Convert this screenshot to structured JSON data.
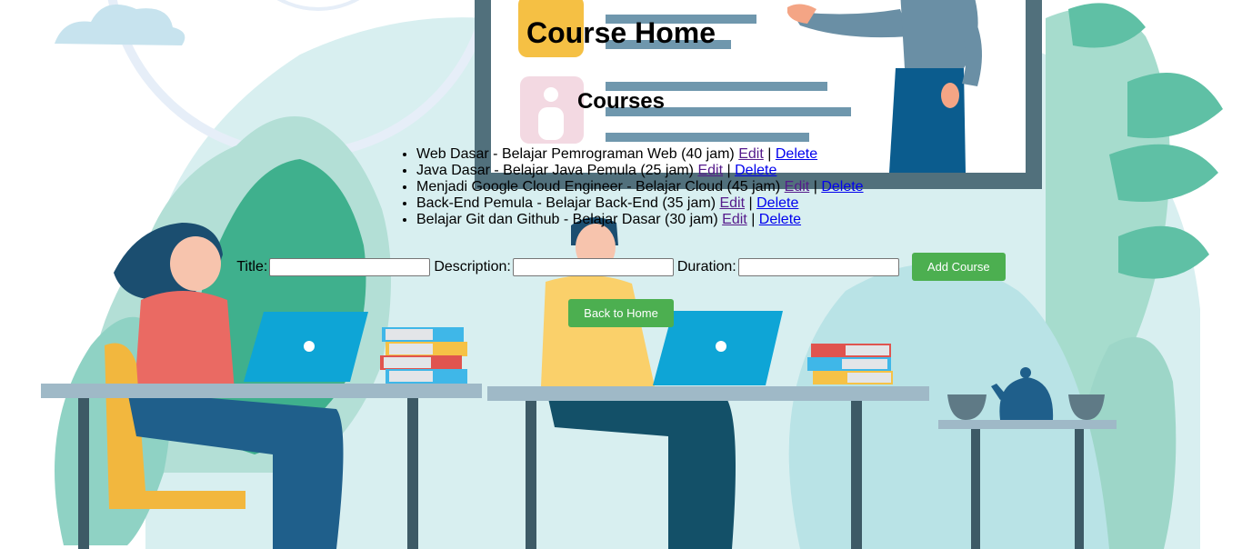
{
  "page": {
    "title": "Course Home",
    "section_title": "Courses"
  },
  "courses": [
    {
      "text": "Web Dasar - Belajar Pemrograman Web (40 jam)",
      "edit": "Edit",
      "sep": "|",
      "delete": "Delete"
    },
    {
      "text": "Java Dasar - Belajar Java Pemula (25 jam)",
      "edit": "Edit",
      "sep": "|",
      "delete": "Delete"
    },
    {
      "text": "Menjadi Google Cloud Engineer - Belajar Cloud (45 jam)",
      "edit": "Edit",
      "sep": "|",
      "delete": "Delete"
    },
    {
      "text": "Back-End Pemula - Belajar Back-End (35 jam)",
      "edit": "Edit",
      "sep": "|",
      "delete": "Delete"
    },
    {
      "text": "Belajar Git dan Github - Belajar Dasar (30 jam)",
      "edit": "Edit",
      "sep": "|",
      "delete": "Delete"
    }
  ],
  "form": {
    "title_label": "Title:",
    "title_value": "",
    "description_label": "Description:",
    "description_value": "",
    "duration_label": "Duration:",
    "duration_value": "",
    "add_button": "Add Course"
  },
  "nav": {
    "back_button": "Back to Home"
  },
  "colors": {
    "button_green": "#4caf50",
    "visited_link": "#551a8b",
    "link": "#0000ee"
  }
}
